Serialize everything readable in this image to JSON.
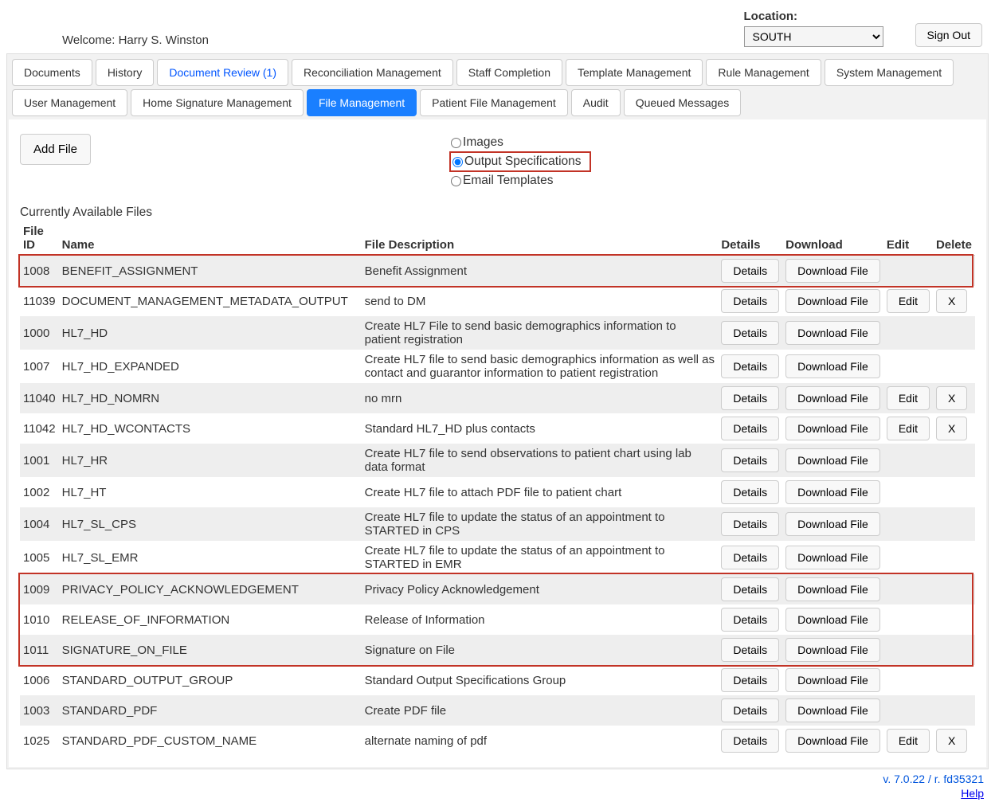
{
  "header": {
    "welcome_prefix": "Welcome: ",
    "user_name": "Harry S. Winston",
    "location_label": "Location:",
    "location_value": "SOUTH",
    "sign_out": "Sign Out"
  },
  "tabs_row1": [
    {
      "label": "Documents"
    },
    {
      "label": "History"
    },
    {
      "label": "Document Review (1)",
      "blue": true
    },
    {
      "label": "Reconciliation Management"
    },
    {
      "label": "Staff Completion"
    },
    {
      "label": "Template Management"
    },
    {
      "label": "Rule Management"
    },
    {
      "label": "System Management"
    }
  ],
  "tabs_row2": [
    {
      "label": "User Management"
    },
    {
      "label": "Home Signature Management"
    },
    {
      "label": "File Management",
      "active": true
    },
    {
      "label": "Patient File Management"
    },
    {
      "label": "Audit"
    },
    {
      "label": "Queued Messages"
    }
  ],
  "controls": {
    "add_file": "Add File",
    "radio_images": "Images",
    "radio_output_specs": "Output Specifications",
    "radio_email_templates": "Email Templates",
    "selected_radio": "output"
  },
  "table": {
    "title": "Currently Available Files",
    "headers": {
      "file_id": "File ID",
      "name": "Name",
      "desc": "File Description",
      "details": "Details",
      "download": "Download",
      "edit": "Edit",
      "delete": "Delete"
    },
    "buttons": {
      "details": "Details",
      "download": "Download File",
      "edit": "Edit",
      "delete": "X"
    },
    "rows": [
      {
        "id": "1008",
        "name": "BENEFIT_ASSIGNMENT",
        "desc": "Benefit Assignment",
        "edit": false,
        "del": false,
        "hl": true
      },
      {
        "id": "11039",
        "name": "DOCUMENT_MANAGEMENT_METADATA_OUTPUT",
        "desc": "send to DM",
        "edit": true,
        "del": true
      },
      {
        "id": "1000",
        "name": "HL7_HD",
        "desc": "Create HL7 File to send basic demographics information to patient registration",
        "edit": false,
        "del": false
      },
      {
        "id": "1007",
        "name": "HL7_HD_EXPANDED",
        "desc": "Create HL7 file to send basic demographics information as well as contact and guarantor information to patient registration",
        "edit": false,
        "del": false
      },
      {
        "id": "11040",
        "name": "HL7_HD_NOMRN",
        "desc": "no mrn",
        "edit": true,
        "del": true
      },
      {
        "id": "11042",
        "name": "HL7_HD_WCONTACTS",
        "desc": "Standard HL7_HD plus contacts",
        "edit": true,
        "del": true
      },
      {
        "id": "1001",
        "name": "HL7_HR",
        "desc": "Create HL7 file to send observations to patient chart using lab data format",
        "edit": false,
        "del": false
      },
      {
        "id": "1002",
        "name": "HL7_HT",
        "desc": "Create HL7 file to attach PDF file to patient chart",
        "edit": false,
        "del": false
      },
      {
        "id": "1004",
        "name": "HL7_SL_CPS",
        "desc": "Create HL7 file to update the status of an appointment to STARTED in CPS",
        "edit": false,
        "del": false
      },
      {
        "id": "1005",
        "name": "HL7_SL_EMR",
        "desc": "Create HL7 file to update the status of an appointment to STARTED in EMR",
        "edit": false,
        "del": false
      },
      {
        "id": "1009",
        "name": "PRIVACY_POLICY_ACKNOWLEDGEMENT",
        "desc": "Privacy Policy Acknowledgement",
        "edit": false,
        "del": false,
        "hl2": true
      },
      {
        "id": "1010",
        "name": "RELEASE_OF_INFORMATION",
        "desc": "Release of Information",
        "edit": false,
        "del": false,
        "hl2": true
      },
      {
        "id": "1011",
        "name": "SIGNATURE_ON_FILE",
        "desc": "Signature on File",
        "edit": false,
        "del": false,
        "hl2": true
      },
      {
        "id": "1006",
        "name": "STANDARD_OUTPUT_GROUP",
        "desc": "Standard Output Specifications Group",
        "edit": false,
        "del": false
      },
      {
        "id": "1003",
        "name": "STANDARD_PDF",
        "desc": "Create PDF file",
        "edit": false,
        "del": false
      },
      {
        "id": "1025",
        "name": "STANDARD_PDF_CUSTOM_NAME",
        "desc": "alternate naming of pdf",
        "edit": true,
        "del": true
      }
    ]
  },
  "footer": {
    "version": "v. 7.0.22 / r. fd35321",
    "help": "Help"
  }
}
